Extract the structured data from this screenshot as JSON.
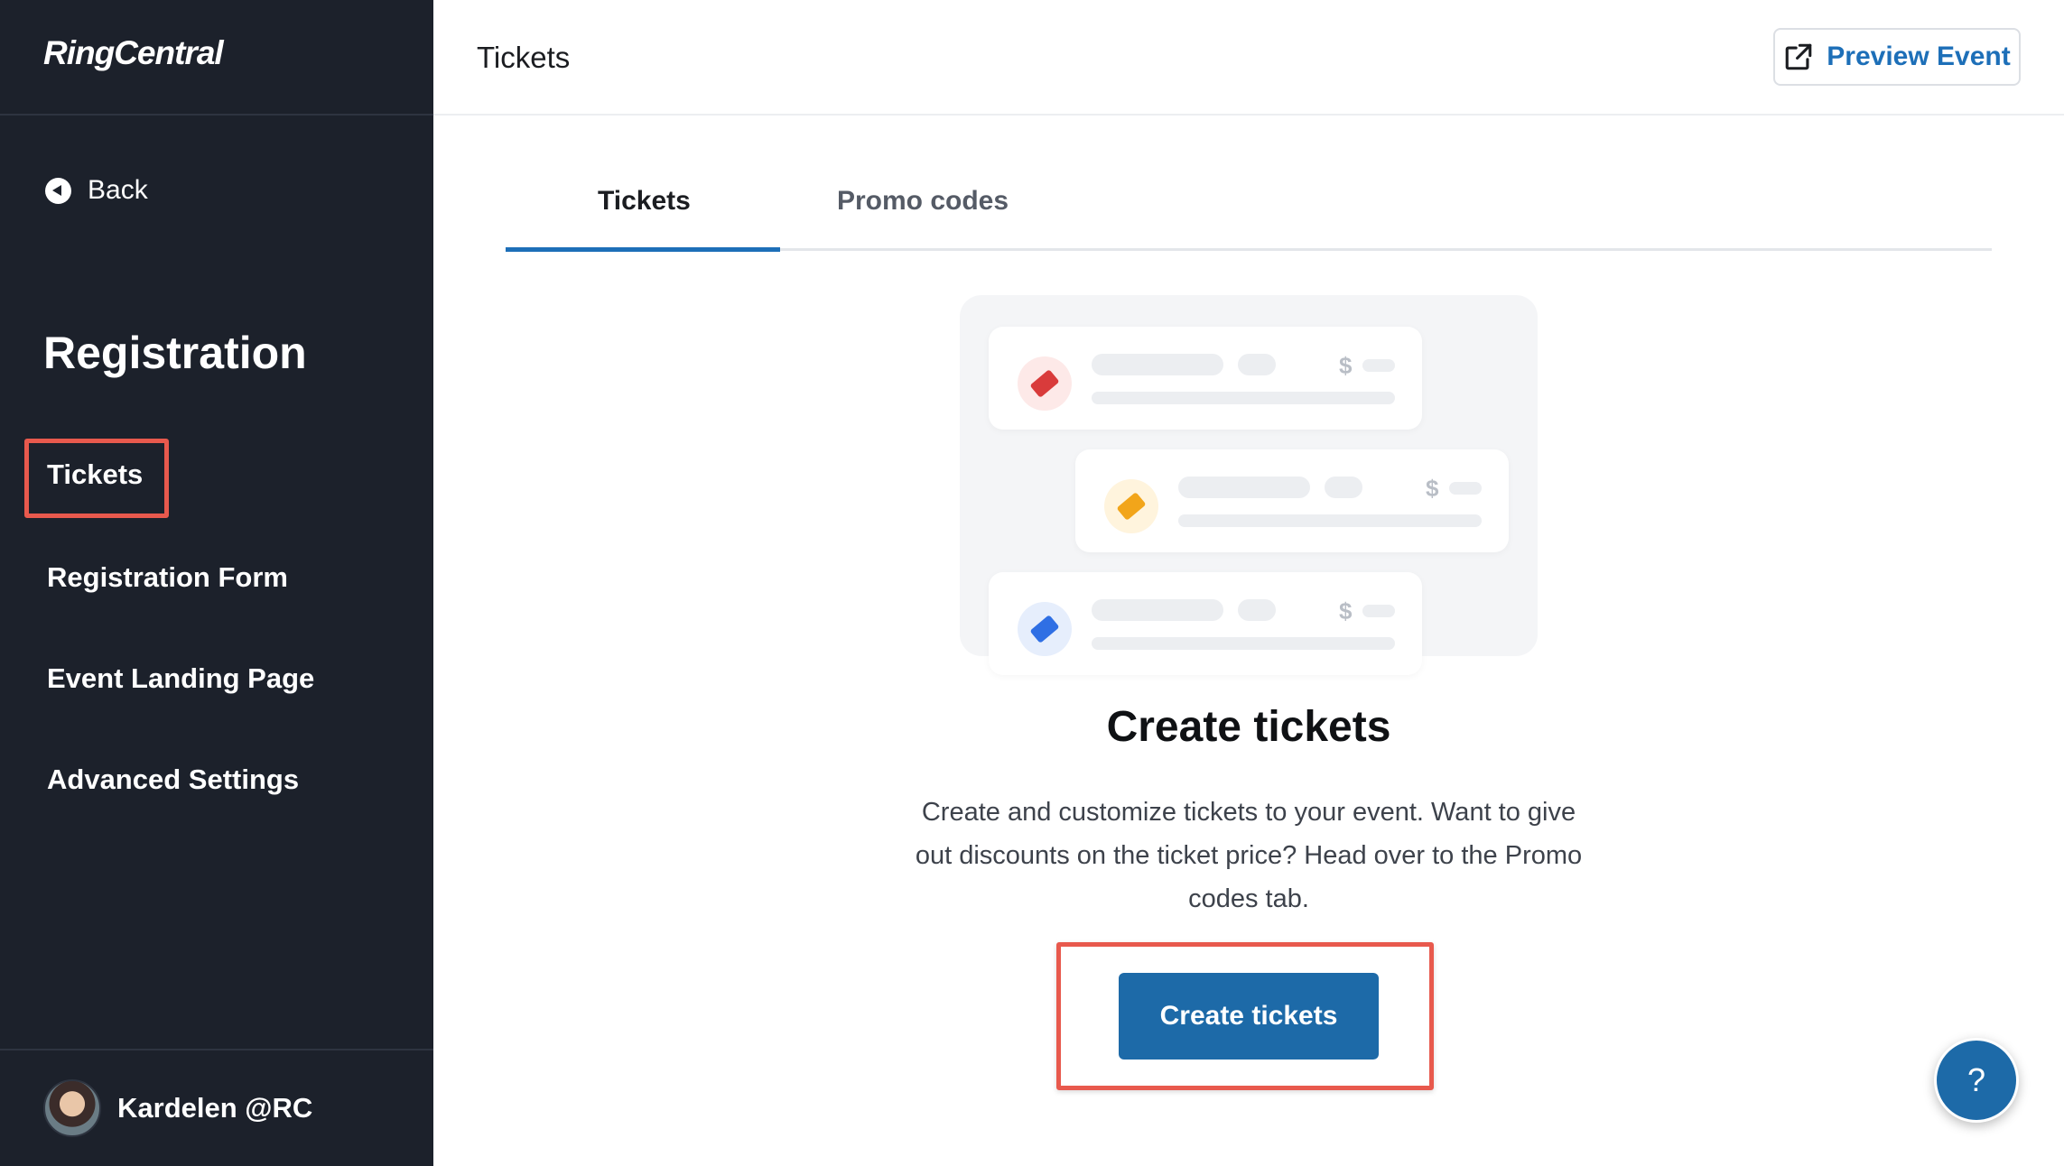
{
  "app": {
    "logo_text": "RingCentral"
  },
  "sidebar": {
    "back_label": "Back",
    "section_title": "Registration",
    "items": [
      {
        "label": "Tickets",
        "active": true
      },
      {
        "label": "Registration Form"
      },
      {
        "label": "Event Landing Page"
      },
      {
        "label": "Advanced Settings"
      }
    ],
    "user_name": "Kardelen @RC"
  },
  "header": {
    "title": "Tickets",
    "preview_label": "Preview Event"
  },
  "tabs": [
    {
      "label": "Tickets",
      "active": true
    },
    {
      "label": "Promo codes",
      "active": false
    }
  ],
  "illustration": {
    "currency": "$",
    "ticket_colors": [
      "#d93b3b",
      "#f2a51a",
      "#2f6fe4"
    ],
    "ticket_bg_colors": [
      "#fde9e8",
      "#fff4dd",
      "#e6eefc"
    ]
  },
  "empty_state": {
    "title": "Create tickets",
    "description": "Create and customize tickets to your event. Want to give out discounts on the ticket price? Head over to the Promo codes tab.",
    "button_label": "Create tickets"
  },
  "help": {
    "label": "?"
  },
  "colors": {
    "sidebar_bg": "#1c212b",
    "accent": "#1d6fb8",
    "highlight": "#e8594d"
  }
}
